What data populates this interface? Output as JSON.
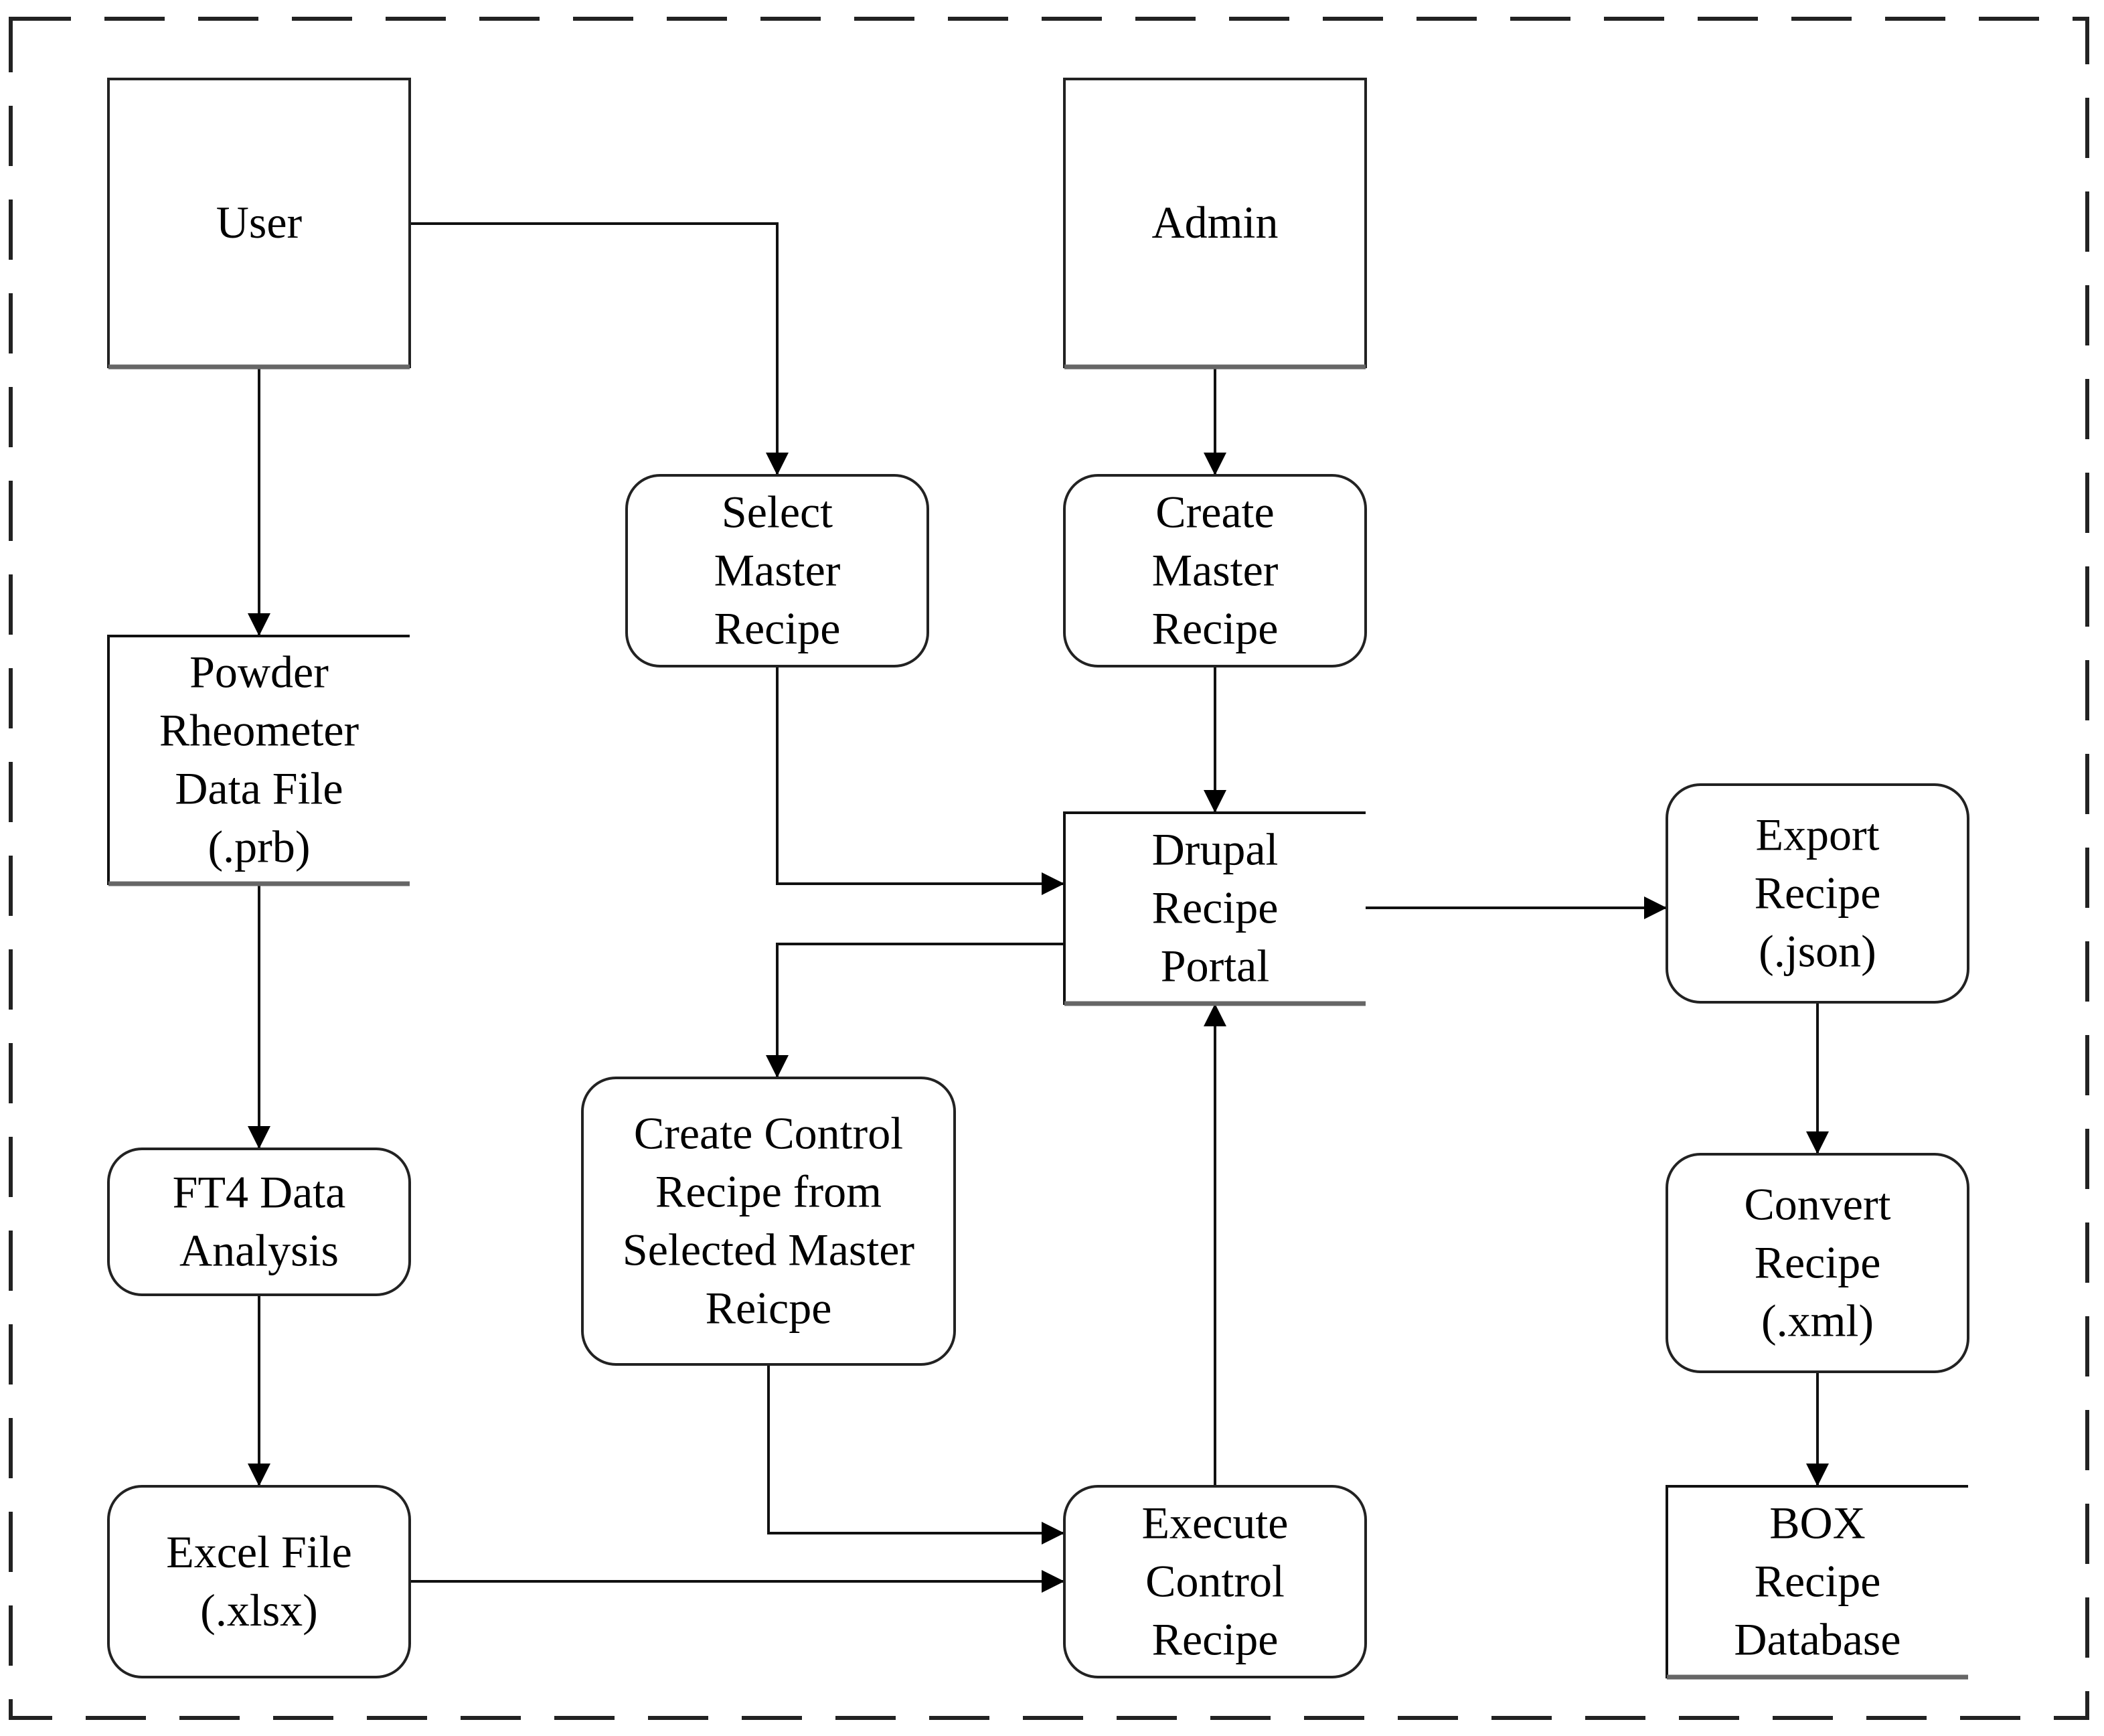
{
  "diagram": {
    "type": "flowchart",
    "border_style": "dashed",
    "nodes": [
      {
        "id": "user",
        "shape": "external-entity",
        "lines": [
          "User"
        ]
      },
      {
        "id": "admin",
        "shape": "external-entity",
        "lines": [
          "Admin"
        ]
      },
      {
        "id": "powder",
        "shape": "data-store",
        "lines": [
          "Powder",
          "Rheometer",
          "Data File",
          "(.prb)"
        ]
      },
      {
        "id": "select",
        "shape": "process",
        "lines": [
          "Select",
          "Master",
          "Recipe"
        ]
      },
      {
        "id": "createmaster",
        "shape": "process",
        "lines": [
          "Create",
          "Master",
          "Recipe"
        ]
      },
      {
        "id": "drupal",
        "shape": "data-store",
        "lines": [
          "Drupal",
          "Recipe",
          "Portal"
        ]
      },
      {
        "id": "export",
        "shape": "process",
        "lines": [
          "Export",
          "Recipe",
          "(.json)"
        ]
      },
      {
        "id": "ft4",
        "shape": "process",
        "lines": [
          "FT4 Data",
          "Analysis"
        ]
      },
      {
        "id": "createcontrol",
        "shape": "process",
        "lines": [
          "Create Control",
          "Recipe from",
          "Selected Master",
          "Reicpe"
        ]
      },
      {
        "id": "convert",
        "shape": "process",
        "lines": [
          "Convert",
          "Recipe",
          "(.xml)"
        ]
      },
      {
        "id": "excel",
        "shape": "process",
        "lines": [
          "Excel File",
          "(.xlsx)"
        ]
      },
      {
        "id": "execute",
        "shape": "process",
        "lines": [
          "Execute",
          "Control",
          "Recipe"
        ]
      },
      {
        "id": "box",
        "shape": "data-store",
        "lines": [
          "BOX",
          "Recipe",
          "Database"
        ]
      }
    ],
    "edges": [
      {
        "from": "user",
        "to": "powder"
      },
      {
        "from": "user",
        "to": "select"
      },
      {
        "from": "admin",
        "to": "createmaster"
      },
      {
        "from": "powder",
        "to": "ft4"
      },
      {
        "from": "ft4",
        "to": "excel"
      },
      {
        "from": "select",
        "to": "drupal"
      },
      {
        "from": "createmaster",
        "to": "drupal"
      },
      {
        "from": "drupal",
        "to": "export"
      },
      {
        "from": "drupal",
        "to": "createcontrol"
      },
      {
        "from": "createcontrol",
        "to": "execute"
      },
      {
        "from": "excel",
        "to": "execute"
      },
      {
        "from": "execute",
        "to": "drupal"
      },
      {
        "from": "export",
        "to": "convert"
      },
      {
        "from": "convert",
        "to": "box"
      }
    ]
  }
}
